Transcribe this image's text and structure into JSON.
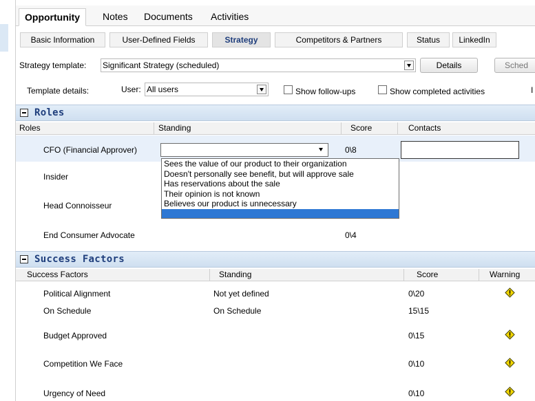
{
  "main_tabs": [
    "Opportunity",
    "Notes",
    "Documents",
    "Activities"
  ],
  "sub_tabs": [
    "Basic Information",
    "User-Defined Fields",
    "Strategy",
    "Competitors & Partners",
    "Status",
    "LinkedIn"
  ],
  "template": {
    "label": "Strategy template:",
    "value": "Significant Strategy (scheduled)",
    "details_button": "Details",
    "schedule_button": "Sched"
  },
  "details_row": {
    "label": "Template details:",
    "user_label": "User:",
    "user_value": "All users",
    "show_followups": "Show follow-ups",
    "show_completed": "Show completed activities",
    "cut_label": "I"
  },
  "roles": {
    "title": "Roles",
    "columns": [
      "Roles",
      "Standing",
      "Score",
      "Contacts"
    ],
    "rows": [
      {
        "name": "CFO (Financial Approver)",
        "standing": "",
        "score": "0\\8"
      },
      {
        "name": "Insider",
        "standing": "",
        "score": ""
      },
      {
        "name": "Head Connoisseur",
        "standing": "",
        "score": ""
      },
      {
        "name": "End Consumer Advocate",
        "standing": "",
        "score": "0\\4"
      }
    ],
    "dropdown_options": [
      "Sees the value of our product to their organization",
      "Doesn't personally see benefit, but will approve sale",
      "Has reservations about the sale",
      "Their opinion is not known",
      "Believes our product is unnecessary",
      ""
    ]
  },
  "success_factors": {
    "title": "Success Factors",
    "columns": [
      "Success Factors",
      "Standing",
      "Score",
      "Warning"
    ],
    "rows": [
      {
        "name": "Political Alignment",
        "standing": "Not yet defined",
        "score": "0\\20",
        "warning": true
      },
      {
        "name": "On Schedule",
        "standing": "On Schedule",
        "score": "15\\15",
        "warning": false
      },
      {
        "name": "Budget Approved",
        "standing": "",
        "score": "0\\15",
        "warning": true
      },
      {
        "name": "Competition We Face",
        "standing": "",
        "score": "0\\10",
        "warning": true
      },
      {
        "name": "Urgency of Need",
        "standing": "",
        "score": "0\\10",
        "warning": true
      }
    ]
  },
  "colors": {
    "accent": "#1f3e7c",
    "header_bg": "#dbe8f5",
    "selected_option": "#2e78d4",
    "warning": "#f2d600"
  },
  "icons": {
    "section_toggle": "minus-box-icon",
    "warning": "warning-diamond-icon",
    "dropdown": "chevron-down-icon"
  }
}
